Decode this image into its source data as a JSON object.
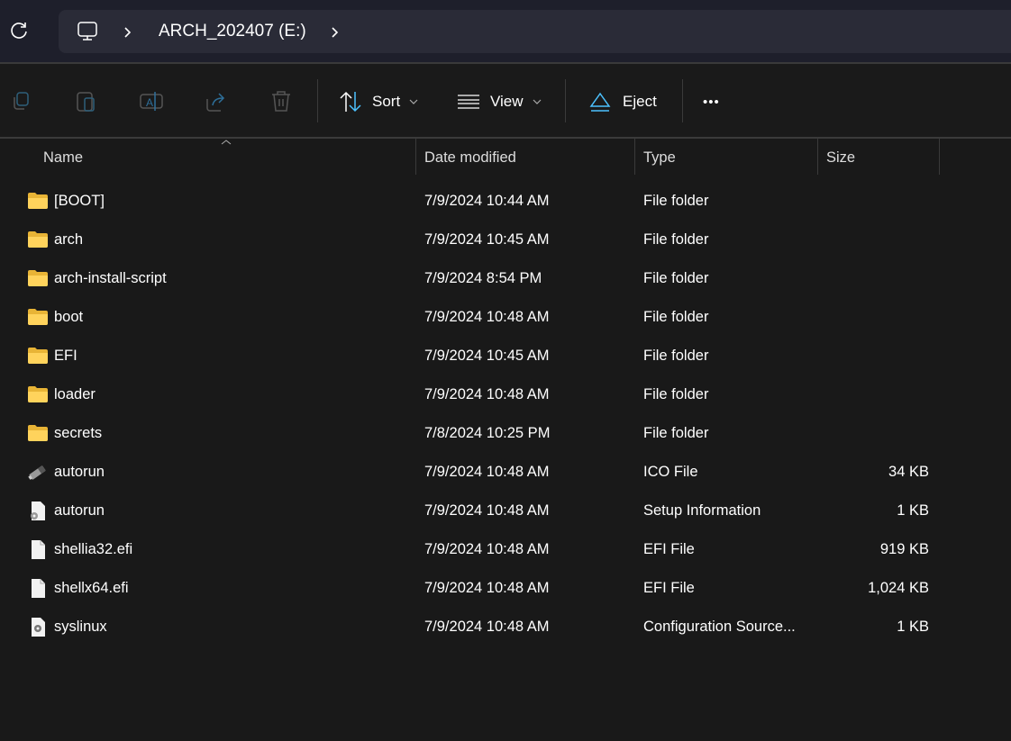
{
  "address_bar": {
    "location": "ARCH_202407 (E:)",
    "icon": "computer-icon"
  },
  "toolbar": {
    "sort_label": "Sort",
    "view_label": "View",
    "eject_label": "Eject",
    "more_label": "•••"
  },
  "columns": {
    "name": "Name",
    "date": "Date modified",
    "type": "Type",
    "size": "Size"
  },
  "accent": "#4cc2ff",
  "files": [
    {
      "name": "[BOOT]",
      "date": "7/9/2024 10:44 AM",
      "type": "File folder",
      "size": "",
      "icon": "folder"
    },
    {
      "name": "arch",
      "date": "7/9/2024 10:45 AM",
      "type": "File folder",
      "size": "",
      "icon": "folder"
    },
    {
      "name": "arch-install-script",
      "date": "7/9/2024 8:54 PM",
      "type": "File folder",
      "size": "",
      "icon": "folder"
    },
    {
      "name": "boot",
      "date": "7/9/2024 10:48 AM",
      "type": "File folder",
      "size": "",
      "icon": "folder"
    },
    {
      "name": "EFI",
      "date": "7/9/2024 10:45 AM",
      "type": "File folder",
      "size": "",
      "icon": "folder"
    },
    {
      "name": "loader",
      "date": "7/9/2024 10:48 AM",
      "type": "File folder",
      "size": "",
      "icon": "folder"
    },
    {
      "name": "secrets",
      "date": "7/8/2024 10:25 PM",
      "type": "File folder",
      "size": "",
      "icon": "folder"
    },
    {
      "name": "autorun",
      "date": "7/9/2024 10:48 AM",
      "type": "ICO File",
      "size": "34 KB",
      "icon": "usb-drive"
    },
    {
      "name": "autorun",
      "date": "7/9/2024 10:48 AM",
      "type": "Setup Information",
      "size": "1 KB",
      "icon": "setup-file"
    },
    {
      "name": "shellia32.efi",
      "date": "7/9/2024 10:48 AM",
      "type": "EFI File",
      "size": "919 KB",
      "icon": "file"
    },
    {
      "name": "shellx64.efi",
      "date": "7/9/2024 10:48 AM",
      "type": "EFI File",
      "size": "1,024 KB",
      "icon": "file"
    },
    {
      "name": "syslinux",
      "date": "7/9/2024 10:48 AM",
      "type": "Configuration Source...",
      "size": "1 KB",
      "icon": "config-file"
    }
  ]
}
